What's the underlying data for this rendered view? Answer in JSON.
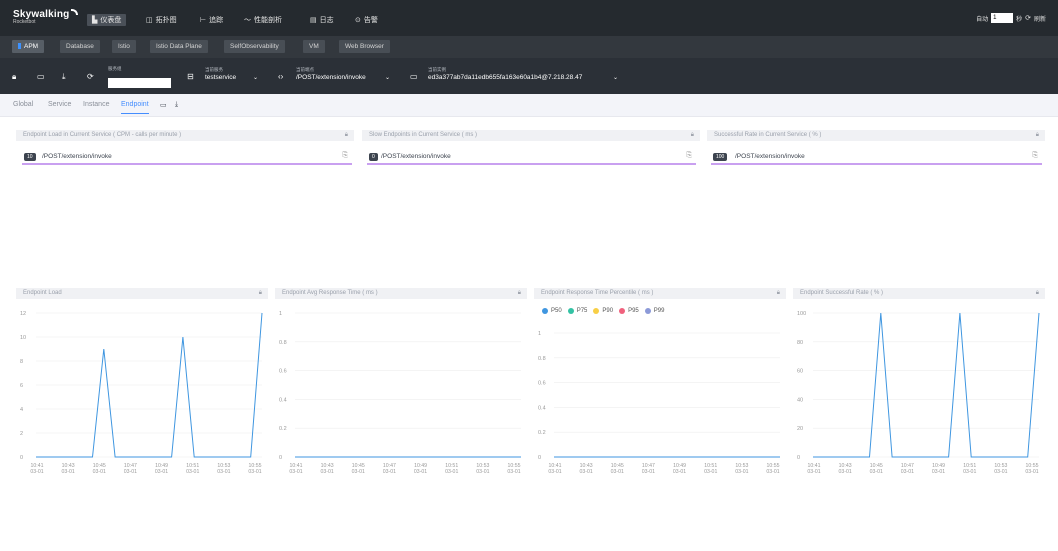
{
  "topbar": {
    "logo_name": "Skywalking",
    "logo_sub": "Rocketbot",
    "nav": [
      {
        "icon": "▙",
        "label": "仪表盘"
      },
      {
        "icon": "◫",
        "label": "拓扑图"
      },
      {
        "icon": "⊢",
        "label": "追踪"
      },
      {
        "icon": "〜",
        "label": "性能剖析"
      },
      {
        "icon": "▤",
        "label": "日志"
      },
      {
        "icon": "⊙",
        "label": "告警"
      }
    ],
    "auto_label": "自动",
    "interval_value": "1",
    "seconds_label": "秒",
    "refresh_label": "刷新"
  },
  "layers": [
    "APM",
    "Database",
    "Istio",
    "Istio Data Plane",
    "SelfObservability",
    "VM",
    "Web Browser"
  ],
  "selectors": {
    "service_group_label": "服务组",
    "service_label": "当前服务",
    "service_value": "testservice",
    "endpoint_label": "当前端点",
    "endpoint_value": "/POST/extension/invoke",
    "instance_label": "当前实例",
    "instance_value": "ed3a377ab7da11edb655fa163e60a1b4@7.218.28.47"
  },
  "tabs": [
    "Global",
    "Service",
    "Instance",
    "Endpoint"
  ],
  "top_panels": [
    {
      "title": "Endpoint Load in Current Service ( CPM - calls per minute )",
      "badge": "10",
      "item": "/POST/extension/invoke"
    },
    {
      "title": "Slow Endpoints in Current Service ( ms )",
      "badge": "0",
      "item": "/POST/extension/invoke"
    },
    {
      "title": "Successful Rate in Current Service ( % )",
      "badge": "100",
      "item": "/POST/extension/invoke"
    }
  ],
  "chart_titles": [
    "Endpoint Load",
    "Endpoint Avg Response Time ( ms )",
    "Endpoint Response Time Percentile ( ms )",
    "Endpoint Successful Rate ( % )"
  ],
  "colors": {
    "line": "#3f96e0",
    "accent": "#448dfe",
    "underline": "#c9a0f0"
  },
  "chart_data": [
    {
      "type": "line",
      "title": "Endpoint Load",
      "x": [
        "10:41\n03-01",
        "10:43\n03-01",
        "10:45\n03-01",
        "10:47\n03-01",
        "10:49\n03-01",
        "10:51\n03-01",
        "10:53\n03-01",
        "10:55\n03-01"
      ],
      "values": [
        0,
        0,
        0,
        0,
        0,
        0,
        9,
        0,
        0,
        0,
        0,
        0,
        0,
        10,
        0,
        0,
        0,
        0,
        0,
        0,
        12
      ],
      "ylim": [
        0,
        12
      ],
      "yticks": [
        0,
        2,
        4,
        6,
        8,
        10,
        12
      ]
    },
    {
      "type": "line",
      "title": "Endpoint Avg Response Time ( ms )",
      "x": [
        "10:41\n03-01",
        "10:43\n03-01",
        "10:45\n03-01",
        "10:47\n03-01",
        "10:49\n03-01",
        "10:51\n03-01",
        "10:53\n03-01",
        "10:55\n03-01"
      ],
      "values": [
        0,
        0,
        0,
        0,
        0,
        0,
        0,
        0,
        0,
        0,
        0,
        0,
        0,
        0,
        0,
        0,
        0,
        0,
        0,
        0,
        0
      ],
      "ylim": [
        0,
        1
      ],
      "yticks": [
        0,
        0.2,
        0.4,
        0.6,
        0.8,
        1
      ]
    },
    {
      "type": "line",
      "title": "Endpoint Response Time Percentile ( ms )",
      "x": [
        "10:41\n03-01",
        "10:43\n03-01",
        "10:45\n03-01",
        "10:47\n03-01",
        "10:49\n03-01",
        "10:51\n03-01",
        "10:53\n03-01",
        "10:55\n03-01"
      ],
      "series": [
        {
          "name": "P50",
          "color": "#3f96e0",
          "values": [
            0,
            0,
            0,
            0,
            0,
            0,
            0,
            0,
            0,
            0,
            0,
            0,
            0,
            0,
            0,
            0,
            0,
            0,
            0,
            0,
            0
          ]
        },
        {
          "name": "P75",
          "color": "#33c2a4",
          "values": [
            0,
            0,
            0,
            0,
            0,
            0,
            0,
            0,
            0,
            0,
            0,
            0,
            0,
            0,
            0,
            0,
            0,
            0,
            0,
            0,
            0
          ]
        },
        {
          "name": "P90",
          "color": "#f8cf46",
          "values": [
            0,
            0,
            0,
            0,
            0,
            0,
            0,
            0,
            0,
            0,
            0,
            0,
            0,
            0,
            0,
            0,
            0,
            0,
            0,
            0,
            0
          ]
        },
        {
          "name": "P95",
          "color": "#f0617d",
          "values": [
            0,
            0,
            0,
            0,
            0,
            0,
            0,
            0,
            0,
            0,
            0,
            0,
            0,
            0,
            0,
            0,
            0,
            0,
            0,
            0,
            0
          ]
        },
        {
          "name": "P99",
          "color": "#8c9ad8",
          "values": [
            0,
            0,
            0,
            0,
            0,
            0,
            0,
            0,
            0,
            0,
            0,
            0,
            0,
            0,
            0,
            0,
            0,
            0,
            0,
            0,
            0
          ]
        }
      ],
      "ylim": [
        0,
        1
      ],
      "yticks": [
        0,
        0.2,
        0.4,
        0.6,
        0.8,
        1
      ]
    },
    {
      "type": "line",
      "title": "Endpoint Successful Rate ( % )",
      "x": [
        "10:41\n03-01",
        "10:43\n03-01",
        "10:45\n03-01",
        "10:47\n03-01",
        "10:49\n03-01",
        "10:51\n03-01",
        "10:53\n03-01",
        "10:55\n03-01"
      ],
      "values": [
        0,
        0,
        0,
        0,
        0,
        0,
        100,
        0,
        0,
        0,
        0,
        0,
        0,
        100,
        0,
        0,
        0,
        0,
        0,
        0,
        100
      ],
      "ylim": [
        0,
        100
      ],
      "yticks": [
        0,
        20,
        40,
        60,
        80,
        100
      ]
    }
  ]
}
